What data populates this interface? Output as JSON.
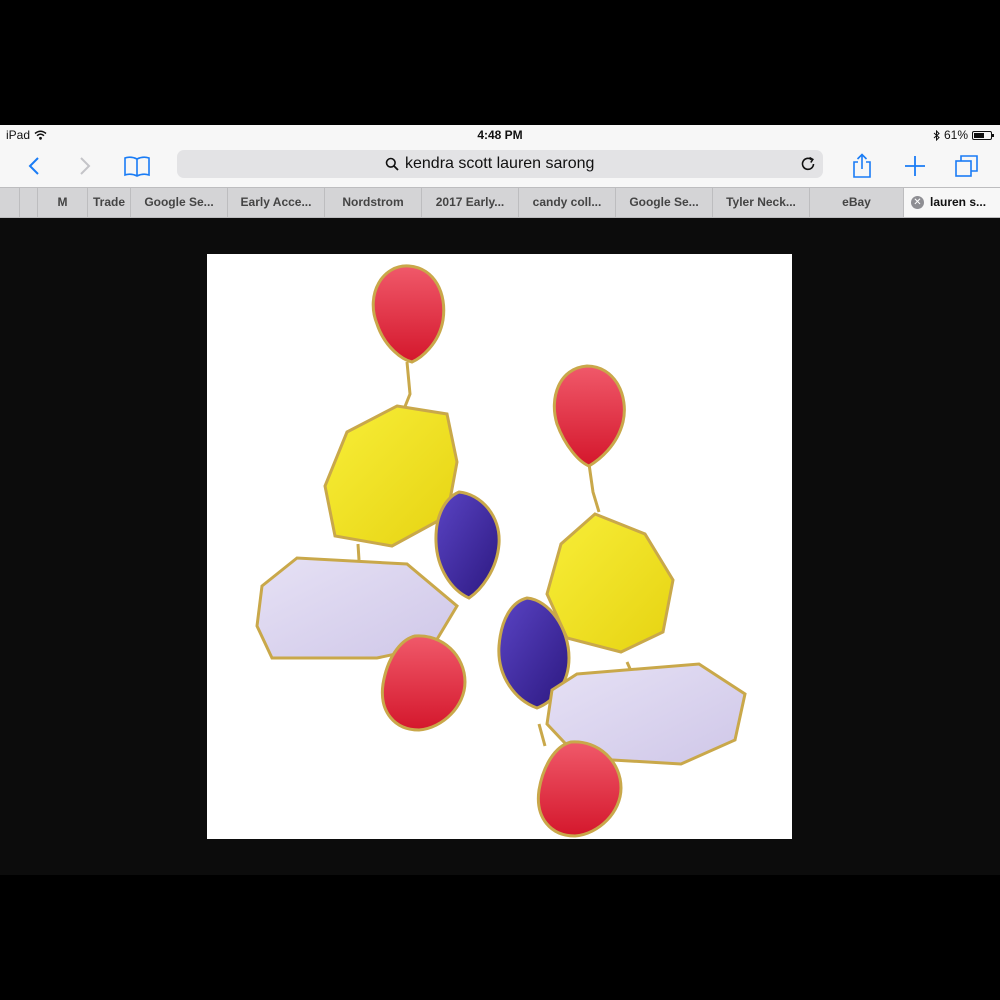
{
  "status": {
    "device": "iPad",
    "time": "4:48 PM",
    "battery": "61%",
    "battery_level": 0.61
  },
  "toolbar": {
    "search_value": "kendra scott lauren sarong",
    "icons": [
      "back-icon",
      "forward-icon",
      "bookmarks-icon",
      "search-icon",
      "reload-icon",
      "share-icon",
      "plus-icon",
      "tabs-icon"
    ]
  },
  "tabs": [
    {
      "label": "M"
    },
    {
      "label": "Trade"
    },
    {
      "label": "Google Se..."
    },
    {
      "label": "Early Acce..."
    },
    {
      "label": "Nordstrom"
    },
    {
      "label": "2017 Early..."
    },
    {
      "label": "candy coll..."
    },
    {
      "label": "Google Se..."
    },
    {
      "label": "Tyler Neck..."
    },
    {
      "label": "eBay"
    },
    {
      "label": "lauren s...",
      "active": true
    }
  ],
  "colors": {
    "accent": "#1a7cf5",
    "stone_red": "#e8283a",
    "stone_yellow": "#f2e41c",
    "stone_purple": "#3a2399",
    "stone_lavender": "#dcd6ee",
    "gold": "#c9a84a"
  }
}
